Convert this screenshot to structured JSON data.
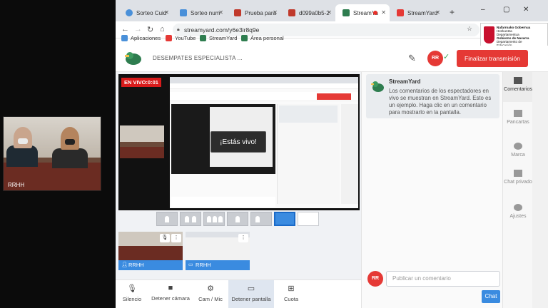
{
  "webcam": {
    "name": "RRHH"
  },
  "browser": {
    "tabs": [
      {
        "label": "Sorteo Cuid",
        "color": "#4a90d9"
      },
      {
        "label": "Sorteo num",
        "color": "#4a90d9"
      },
      {
        "label": "Prueba para",
        "color": "#c0392b"
      },
      {
        "label": "d099a0b5-2",
        "color": "#c0392b"
      },
      {
        "label": "StreamYa",
        "color": "#2e7d4f",
        "active": true,
        "recording": true
      },
      {
        "label": "StreamYard",
        "color": "#2e7d4f"
      }
    ],
    "new_tab": "+",
    "window_controls": [
      "–",
      "▢",
      "✕"
    ],
    "url": "streamyard.com/y6e3ir8q9e",
    "bookmarks": [
      {
        "label": "Aplicaciones",
        "color": "#4a90d9"
      },
      {
        "label": "YouTube",
        "color": "#e53935"
      },
      {
        "label": "StreamYard",
        "color": "#2e7d4f"
      },
      {
        "label": "Área personal",
        "color": "#2e7d4f"
      }
    ]
  },
  "navarra": {
    "line1": "Nafarroako Gobernua",
    "line2": "Hezkuntza",
    "line3": "Departamentua",
    "line4": "Gobierno de Navarra",
    "line5": "Departamento de",
    "line6": "Educación"
  },
  "header": {
    "title": "DESEMPATES ESPECIALISTA ...",
    "destination_badge": "RR",
    "end_button": "Finalizar transmisión"
  },
  "stage": {
    "live_badge": "EN VIVO:0:01",
    "live_popup": "¡Estás vivo!"
  },
  "guests": [
    {
      "name": "RRHH",
      "type": "camera"
    },
    {
      "name": "RRHH",
      "type": "screen"
    }
  ],
  "controls": [
    {
      "label": "Silencio",
      "icon": "mic-icon"
    },
    {
      "label": "Detener cámara",
      "icon": "camera-icon"
    },
    {
      "label": "Cam / Mic",
      "icon": "gear-icon"
    },
    {
      "label": "Detener pantalla",
      "icon": "screen-icon",
      "active": true
    },
    {
      "label": "Cuota",
      "icon": "share-icon"
    }
  ],
  "chat": {
    "sender": "StreamYard",
    "message": "Los comentarios de los espectadores en vivo se muestran en StreamYard. Esto es un ejemplo. Haga clic en un comentario para mostrarlo en la pantalla.",
    "comment_placeholder": "Publicar un comentario",
    "send_button": "Chat",
    "avatar_badge": "RR"
  },
  "sidebar": [
    {
      "label": "Comentarios",
      "active": true
    },
    {
      "label": "Pancartas"
    },
    {
      "label": "Marca"
    },
    {
      "label": "Chat privado"
    },
    {
      "label": "Ajustes"
    }
  ],
  "colors": {
    "accent": "#3a8be0",
    "danger": "#e53935",
    "brand": "#2e7d4f"
  }
}
